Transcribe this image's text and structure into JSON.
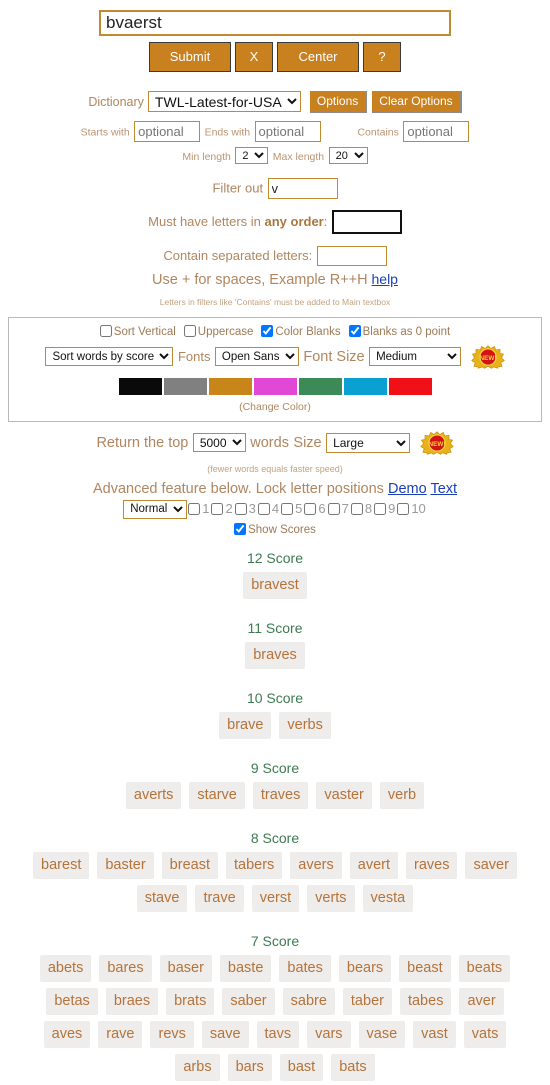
{
  "search": {
    "value": "bvaerst",
    "placeholder": ""
  },
  "buttons": {
    "submit": "Submit",
    "clear": "X",
    "center": "Center",
    "help": "?"
  },
  "dictionary": {
    "label": "Dictionary",
    "selected": "TWL-Latest-for-USA",
    "options_button": "Options",
    "clear_options_button": "Clear Options"
  },
  "filters": {
    "starts_with_label": "Starts with",
    "starts_with_value": "",
    "starts_with_placeholder": "optional",
    "ends_with_label": "Ends with",
    "ends_with_value": "",
    "ends_with_placeholder": "optional",
    "contains_label": "Contains",
    "contains_value": "",
    "contains_placeholder": "optional",
    "min_length_label": "Min length",
    "min_length_value": "2",
    "max_length_label": "Max length",
    "max_length_value": "20",
    "filter_out_label": "Filter out",
    "filter_out_value": "v",
    "must_have_label_a": "Must have letters in ",
    "must_have_label_b": "any order",
    "must_have_label_c": ":",
    "must_have_value": "",
    "separated_label": "Contain separated letters:",
    "separated_value": "",
    "use_plus_text": "Use + for spaces, Example R++H",
    "help_link": "help",
    "note": "Letters in filters like 'Contains' must be added to Main textbox"
  },
  "options_panel": {
    "sort_vertical": "Sort Vertical",
    "sort_vertical_checked": false,
    "uppercase": "Uppercase",
    "uppercase_checked": false,
    "color_blanks": "Color Blanks",
    "color_blanks_checked": true,
    "blanks_zero": "Blanks as 0 point",
    "blanks_zero_checked": true,
    "sort_selected": "Sort words by score",
    "fonts_label": "Fonts",
    "fonts_selected": "Open Sans",
    "font_size_label": "Font Size",
    "font_size_selected": "Medium",
    "new_badge": "NEW!",
    "change_color_label": "(Change Color)",
    "swatches": [
      "#0a0a0a",
      "#808080",
      "#c8861a",
      "#e148d6",
      "#3b8a57",
      "#0aa1d2",
      "#ef1018"
    ]
  },
  "return_row": {
    "prefix": "Return the top",
    "count": "5000",
    "suffix": "words",
    "size_label": "Size",
    "size_value": "Large",
    "new_badge": "NEW!",
    "hint": "(fewer words equals faster speed)"
  },
  "advanced": {
    "text": "Advanced feature below. Lock letter positions",
    "demo_link": "Demo",
    "text_link": "Text",
    "mode_selected": "Normal",
    "positions": [
      "1",
      "2",
      "3",
      "4",
      "5",
      "6",
      "7",
      "8",
      "9",
      "10"
    ],
    "show_scores_label": "Show Scores",
    "show_scores_checked": true
  },
  "results": {
    "score_suffix": "Score",
    "groups": [
      {
        "score": "12",
        "heading": "12 Score",
        "rows": [
          [
            "bravest"
          ]
        ]
      },
      {
        "score": "11",
        "heading": "11 Score",
        "rows": [
          [
            "braves"
          ]
        ]
      },
      {
        "score": "10",
        "heading": "10 Score",
        "rows": [
          [
            "brave",
            "verbs"
          ]
        ]
      },
      {
        "score": "9",
        "heading": "9 Score",
        "rows": [
          [
            "averts",
            "starve",
            "traves",
            "vaster",
            "verb"
          ]
        ]
      },
      {
        "score": "8",
        "heading": "8 Score",
        "rows": [
          [
            "barest",
            "baster",
            "breast",
            "tabers",
            "avers",
            "avert",
            "raves",
            "saver"
          ],
          [
            "stave",
            "trave",
            "verst",
            "verts",
            "vesta"
          ]
        ]
      },
      {
        "score": "7",
        "heading": "7 Score",
        "rows": [
          [
            "abets",
            "bares",
            "baser",
            "baste",
            "bates",
            "bears",
            "beast",
            "beats"
          ],
          [
            "betas",
            "braes",
            "brats",
            "saber",
            "sabre",
            "taber",
            "tabes",
            "aver"
          ],
          [
            "aves",
            "rave",
            "revs",
            "save",
            "tavs",
            "vars",
            "vase",
            "vast",
            "vats"
          ],
          [
            "arbs",
            "bars",
            "bast",
            "bats"
          ]
        ]
      }
    ]
  },
  "theme": {
    "accent": "#c8811e",
    "gold_border": "#c08a2e",
    "label_color": "#b08660",
    "score_color": "#3d7a50",
    "word_bg": "#eeedeb",
    "word_color": "#b5733a"
  }
}
